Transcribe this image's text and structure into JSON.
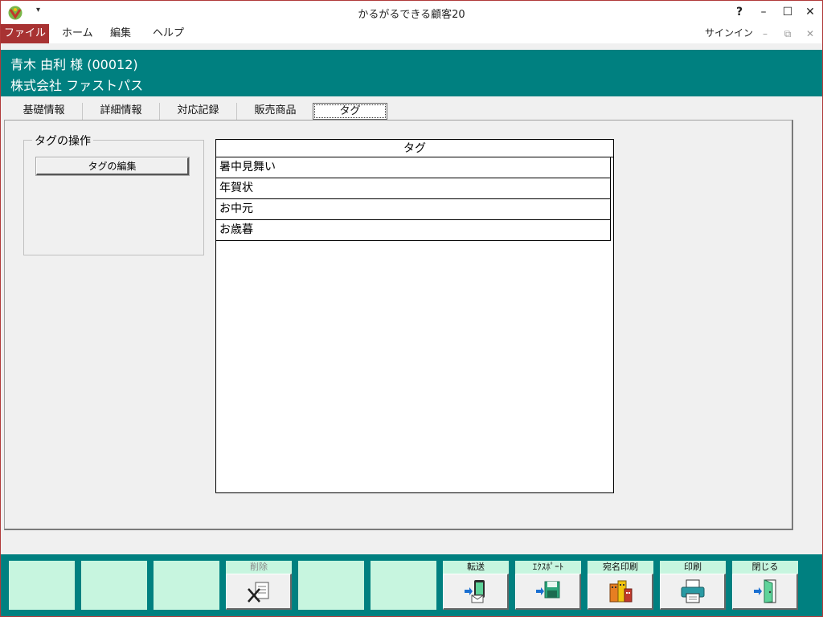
{
  "titlebar": {
    "title": "かるがるできる顧客20",
    "quick_access": "▾",
    "help": "?",
    "minimize": "–",
    "maximize": "☐",
    "close": "✕"
  },
  "menu": {
    "items": [
      "ファイル",
      "ホーム",
      "編集",
      "ヘルプ"
    ],
    "signin": "サインイン",
    "min": "–",
    "restore": "⧉",
    "close": "✕"
  },
  "header": {
    "customer": "青木 由利 様 (00012)",
    "company": "株式会社 ファストパス"
  },
  "tabs": [
    "基礎情報",
    "詳細情報",
    "対応記録",
    "販売商品",
    "タグ"
  ],
  "active_tab": "タグ",
  "tag_ops": {
    "title": "タグの操作",
    "edit_button": "タグの編集"
  },
  "tag_table": {
    "header": "タグ",
    "rows": [
      "暑中見舞い",
      "年賀状",
      "お中元",
      "お歳暮"
    ]
  },
  "function_buttons": [
    {
      "label": "",
      "icon": ""
    },
    {
      "label": "",
      "icon": ""
    },
    {
      "label": "",
      "icon": ""
    },
    {
      "label": "削除",
      "icon": "delete-icon",
      "disabled": true
    },
    {
      "label": "",
      "icon": ""
    },
    {
      "label": "",
      "icon": ""
    },
    {
      "label": "転送",
      "icon": "transfer-icon"
    },
    {
      "label": "ｴｸｽﾎﾟｰﾄ",
      "icon": "export-icon"
    },
    {
      "label": "宛名印刷",
      "icon": "address-print-icon"
    },
    {
      "label": "印刷",
      "icon": "printer-icon"
    },
    {
      "label": "閉じる",
      "icon": "close-door-icon"
    }
  ],
  "colors": {
    "accent": "#008080",
    "file_menu": "#a83232",
    "button_face": "#c7f5df"
  }
}
